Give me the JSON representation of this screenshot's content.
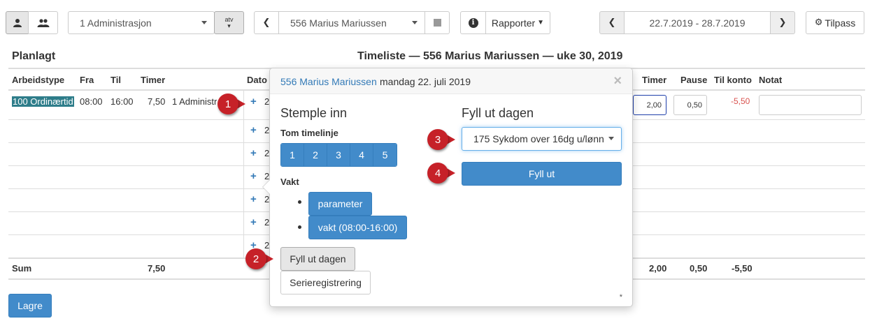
{
  "toolbar": {
    "employee_select": "1 Administrasjon",
    "atv_label": "atv",
    "person_select": "556 Marius Mariussen",
    "reports_label": "Rapporter",
    "date_range": "22.7.2019 - 28.7.2019",
    "customize_label": "Tilpass"
  },
  "page": {
    "section_label": "Planlagt",
    "title": "Timeliste — 556 Marius Mariussen — uke 30, 2019"
  },
  "table": {
    "headers": {
      "worktype": "Arbeidstype",
      "from": "Fra",
      "to": "Til",
      "hours": "Timer",
      "date": "Dato",
      "hours2": "Timer",
      "pause": "Pause",
      "to_account": "Til konto",
      "note": "Notat"
    },
    "row1": {
      "worktype": "100 Ordinærtid",
      "from": "08:00",
      "to": "16:00",
      "hours": "7,50",
      "dept": "1 Administr",
      "hours_value": "2,00",
      "pause_value": "0,50",
      "to_account": "-5,50",
      "note": ""
    },
    "date_stub": "2",
    "sum": {
      "label": "Sum",
      "planned_hours": "7,50",
      "hours": "2,00",
      "pause": "0,50",
      "to_account": "-5,50"
    }
  },
  "popover": {
    "person_link": "556 Marius Mariussen",
    "date_text": "mandag 22. juli 2019",
    "close": "×",
    "left_heading": "Stemple inn",
    "empty_timeline_label": "Tom timelinje",
    "numbers": [
      "1",
      "2",
      "3",
      "4",
      "5"
    ],
    "shift_label": "Vakt",
    "shift_items": [
      "parameter",
      "vakt (08:00-16:00)"
    ],
    "fill_day_button": "Fyll ut dagen",
    "series_button": "Serieregistrering",
    "right_heading": "Fyll ut dagen",
    "worktype_select": "175 Sykdom over 16dg u/lønn",
    "fill_button": "Fyll ut",
    "footnote": "*"
  },
  "save_button": "Lagre",
  "markers": [
    "1",
    "2",
    "3",
    "4"
  ],
  "colors": {
    "primary": "#428bca",
    "marker": "#c62128",
    "negative": "#d9534f",
    "highlight": "#2e7d8a"
  }
}
